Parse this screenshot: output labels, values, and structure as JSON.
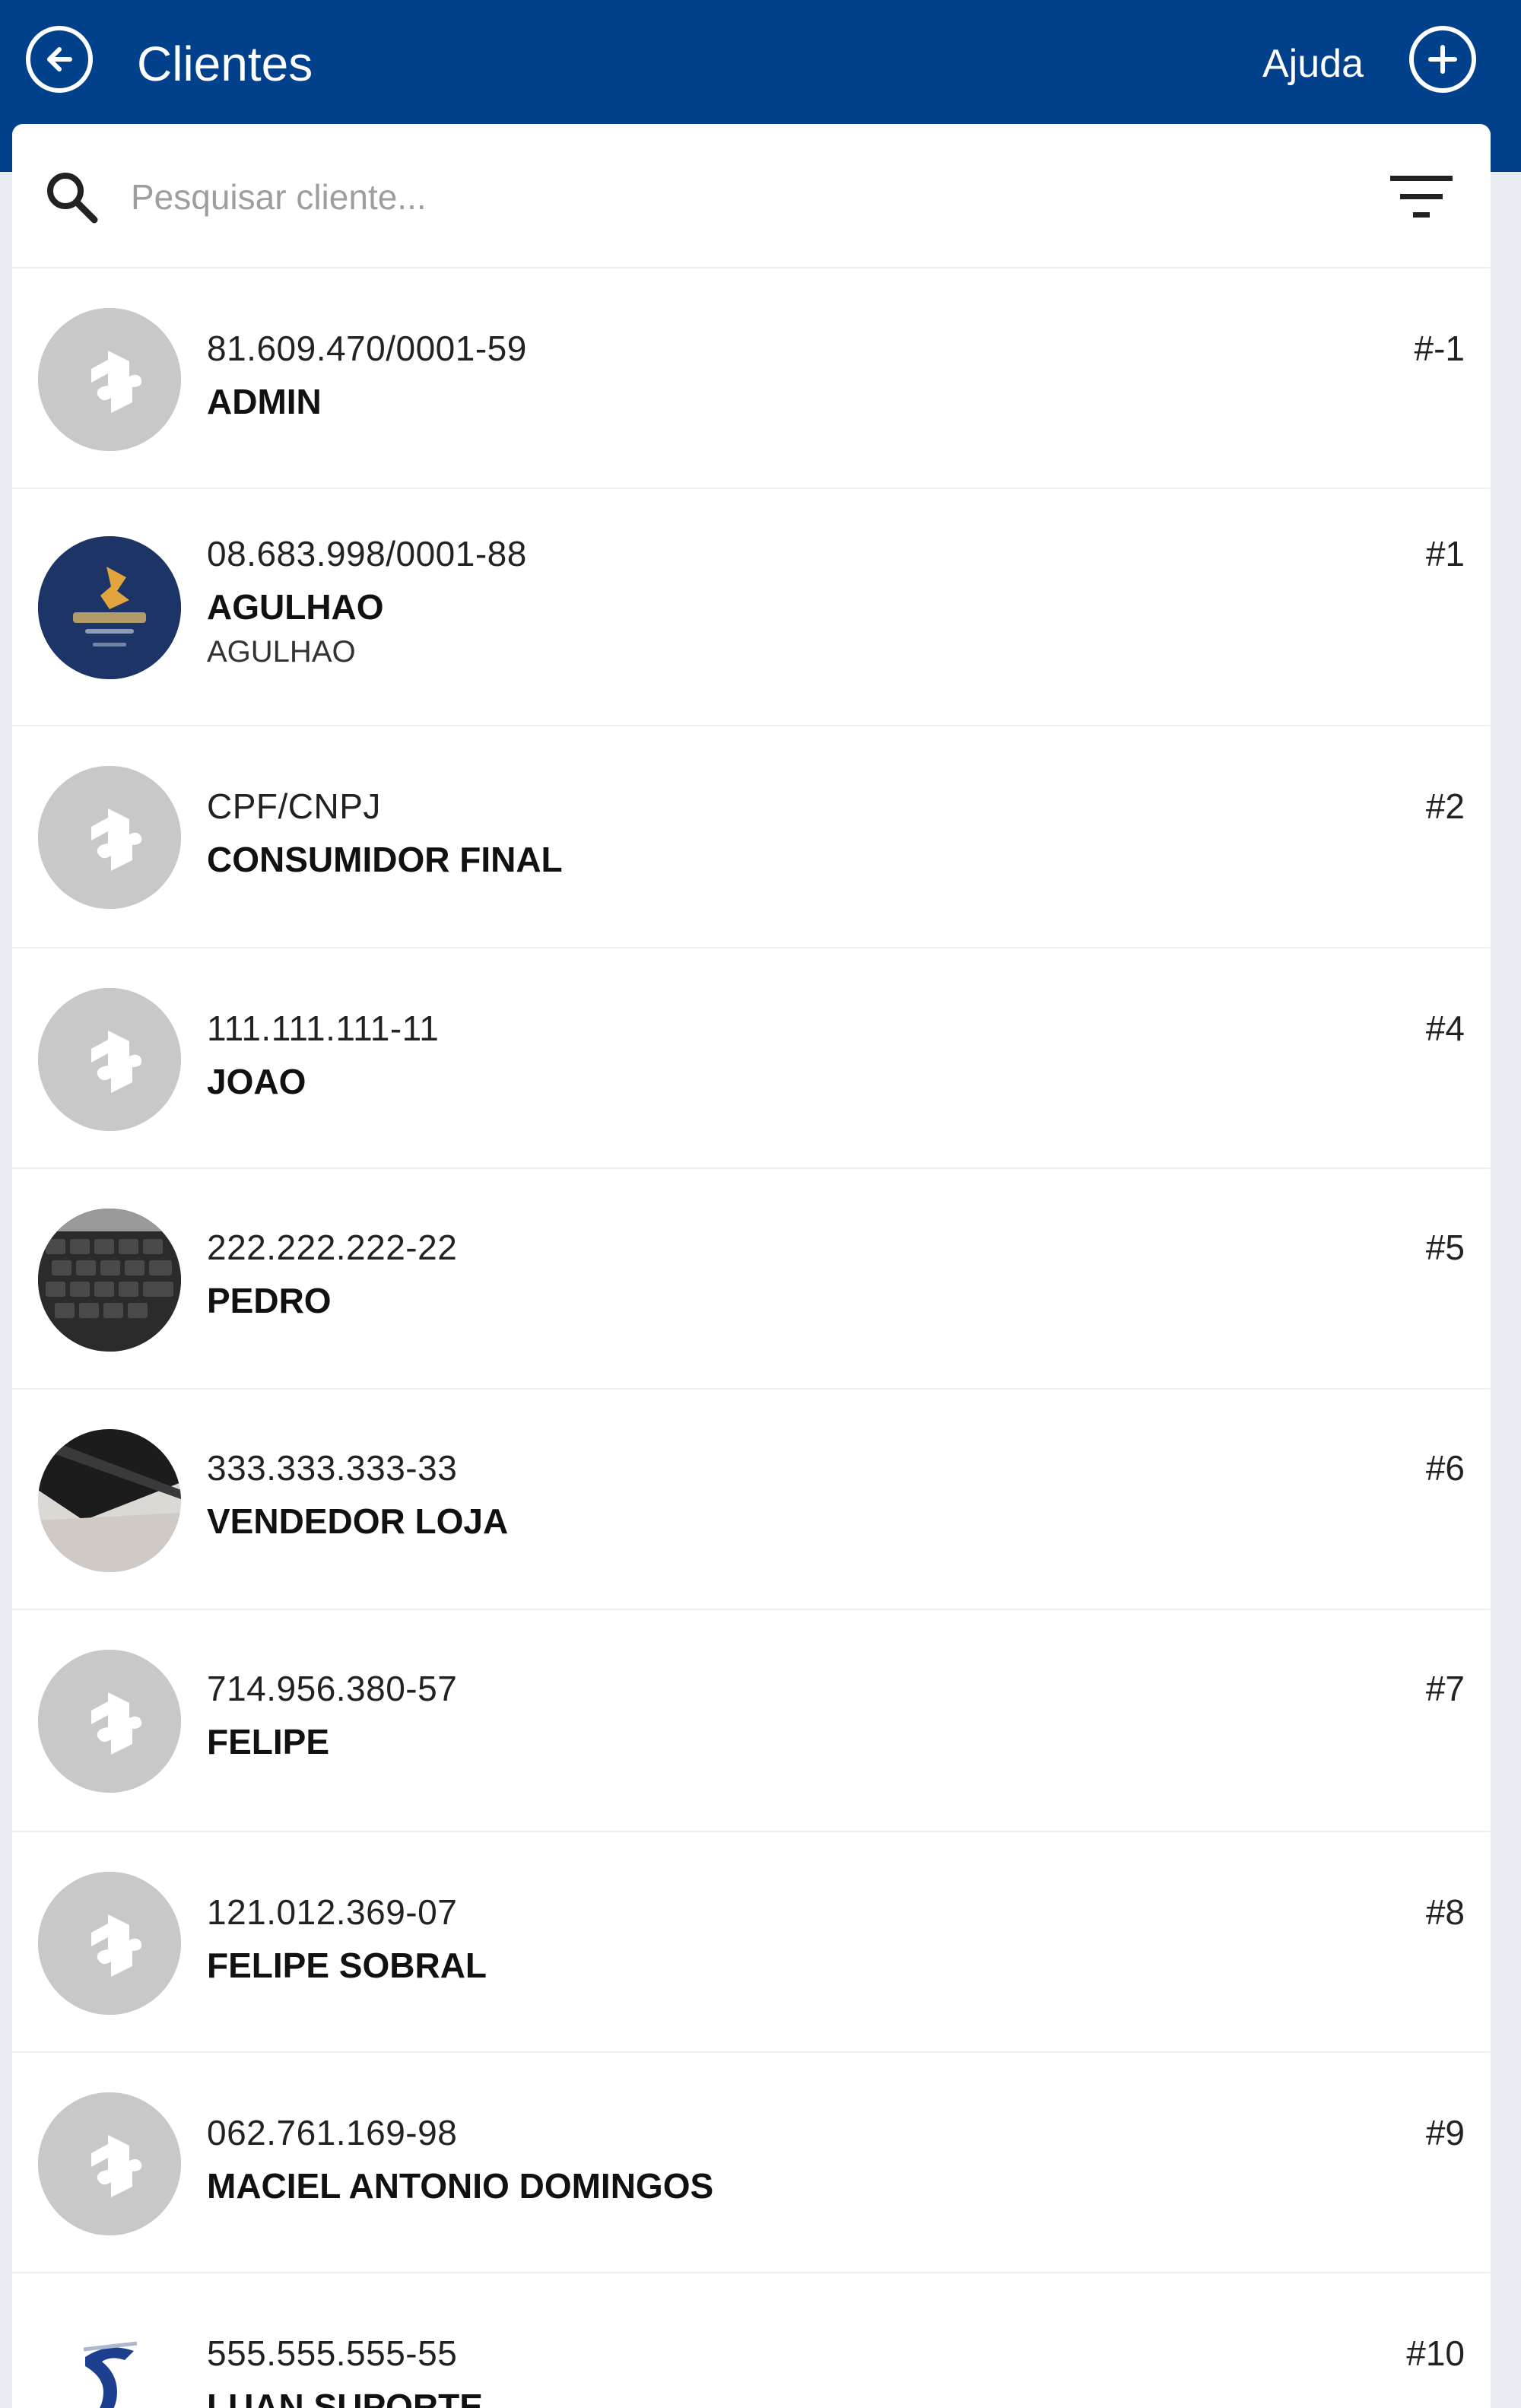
{
  "header": {
    "title": "Clientes",
    "help_label": "Ajuda",
    "back_icon": "arrow-left-circle-icon",
    "add_icon": "plus-circle-icon",
    "background": "#01408b"
  },
  "search": {
    "placeholder": "Pesquisar cliente...",
    "value": "",
    "search_icon": "search-icon",
    "filter_icon": "filter-icon"
  },
  "clients": [
    {
      "doc": "81.609.470/0001-59",
      "name": "ADMIN",
      "subname": "",
      "code": "#-1",
      "avatar": "placeholder-puzzle"
    },
    {
      "doc": "08.683.998/0001-88",
      "name": "AGULHAO",
      "subname": "AGULHAO",
      "code": "#1",
      "avatar": "agulhao-logo-photo"
    },
    {
      "doc": "CPF/CNPJ",
      "name": "CONSUMIDOR FINAL",
      "subname": "",
      "code": "#2",
      "avatar": "placeholder-puzzle"
    },
    {
      "doc": "111.111.111-11",
      "name": "JOAO",
      "subname": "",
      "code": "#4",
      "avatar": "placeholder-puzzle"
    },
    {
      "doc": "222.222.222-22",
      "name": "PEDRO",
      "subname": "",
      "code": "#5",
      "avatar": "keyboard-photo"
    },
    {
      "doc": "333.333.333-33",
      "name": "VENDEDOR LOJA",
      "subname": "",
      "code": "#6",
      "avatar": "desk-photo"
    },
    {
      "doc": "714.956.380-57",
      "name": "FELIPE",
      "subname": "",
      "code": "#7",
      "avatar": "placeholder-puzzle"
    },
    {
      "doc": "121.012.369-07",
      "name": "FELIPE SOBRAL",
      "subname": "",
      "code": "#8",
      "avatar": "placeholder-puzzle"
    },
    {
      "doc": "062.761.169-98",
      "name": "MACIEL ANTONIO DOMINGOS",
      "subname": "",
      "code": "#9",
      "avatar": "placeholder-puzzle"
    },
    {
      "doc": "555.555.555-55",
      "name": "LUAN SUPORTE",
      "subname": "",
      "code": "#10",
      "avatar": "company-logo"
    }
  ]
}
